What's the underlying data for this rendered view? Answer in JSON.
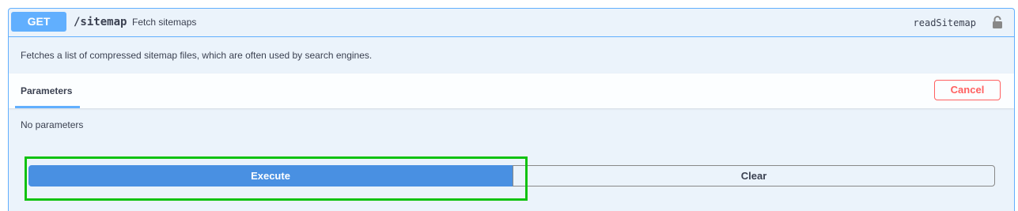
{
  "operation": {
    "method": "GET",
    "path": "/sitemap",
    "summary": "Fetch sitemaps",
    "operation_id": "readSitemap",
    "description": "Fetches a list of compressed sitemap files, which are often used by search engines."
  },
  "parameters": {
    "tab_label": "Parameters",
    "cancel_label": "Cancel",
    "empty_text": "No parameters"
  },
  "actions": {
    "execute_label": "Execute",
    "clear_label": "Clear"
  },
  "icons": {
    "lock": "lock-icon"
  },
  "colors": {
    "method_get": "#61affe",
    "execute": "#4990e2",
    "cancel": "#ff6060",
    "highlight": "#11c211",
    "block_bg": "#ebf3fb"
  }
}
